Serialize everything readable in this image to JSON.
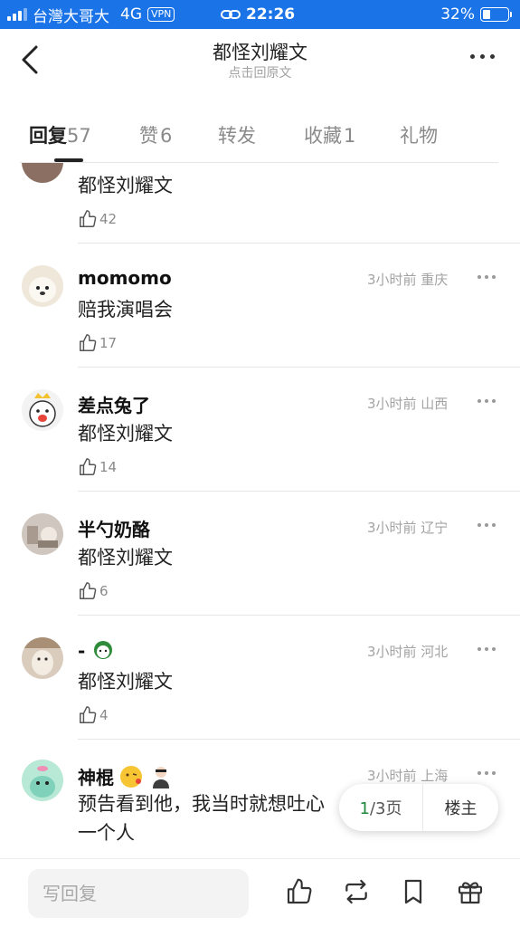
{
  "status_bar": {
    "carrier": "台灣大哥大",
    "network": "4G",
    "vpn": "VPN",
    "time": "22:26",
    "battery": "32%",
    "battery_level": 0.32
  },
  "nav": {
    "title": "都怪刘耀文",
    "subtitle": "点击回原文"
  },
  "tabs": [
    {
      "label": "回复",
      "count": "57"
    },
    {
      "label": "赞",
      "count": "6"
    },
    {
      "label": "转发",
      "count": ""
    },
    {
      "label": "收藏",
      "count": "1"
    },
    {
      "label": "礼物",
      "count": ""
    }
  ],
  "comments": [
    {
      "name": "",
      "meta": "",
      "content": "都怪刘耀文",
      "likes": "42"
    },
    {
      "name": "momomo",
      "meta": "3小时前 重庆",
      "content": "赔我演唱会",
      "likes": "17"
    },
    {
      "name": "差点兔了",
      "meta": "3小时前 山西",
      "content": "都怪刘耀文",
      "likes": "14"
    },
    {
      "name": "半勺奶酪",
      "meta": "3小时前 辽宁",
      "content": "都怪刘耀文",
      "likes": "6"
    },
    {
      "name": "-",
      "meta": "3小时前 河北",
      "content": "都怪刘耀文",
      "likes": "4"
    },
    {
      "name": "神棍",
      "meta": "3小时前 上海",
      "content": "预告看到他，我当时就想吐心一个人",
      "likes": ""
    }
  ],
  "pager": {
    "current": "1",
    "total": "/3页",
    "owner": "楼主"
  },
  "bottom_bar": {
    "reply_placeholder": "写回复"
  },
  "colors": {
    "status_bar": "#1a74e8",
    "pager_current": "#1f8a3e"
  }
}
